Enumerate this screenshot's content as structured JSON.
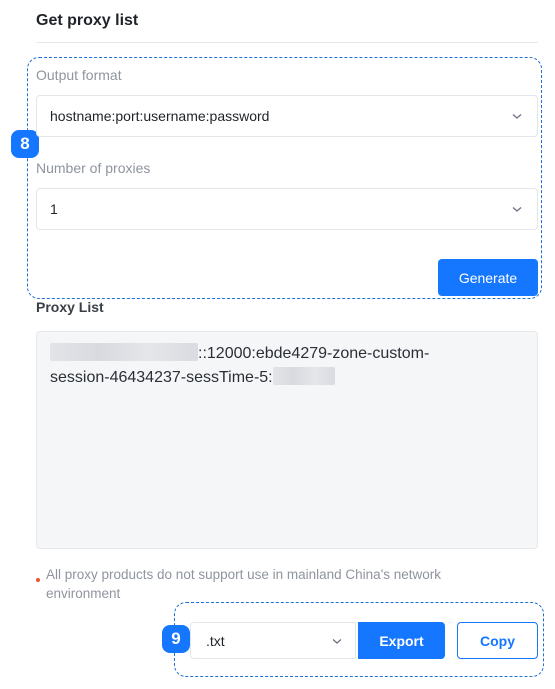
{
  "section_title": "Get proxy list",
  "output_format": {
    "label": "Output format",
    "value": "hostname:port:username:password"
  },
  "number_of_proxies": {
    "label": "Number of proxies",
    "value": "1"
  },
  "generate_label": "Generate",
  "proxy_list": {
    "label": "Proxy List",
    "line1_visible": "::12000:ebde4279-zone-custom-",
    "line2_visible": "session-46434237-sessTime-5:"
  },
  "notice": "All proxy products do not support use in mainland China's network environment",
  "export": {
    "format_value": ".txt",
    "export_label": "Export",
    "copy_label": "Copy"
  },
  "step_badges": {
    "first": "8",
    "second": "9"
  },
  "colors": {
    "accent": "#1577ff",
    "dashed_outline": "#1f6fd6",
    "warning_dot": "#f0532f"
  }
}
